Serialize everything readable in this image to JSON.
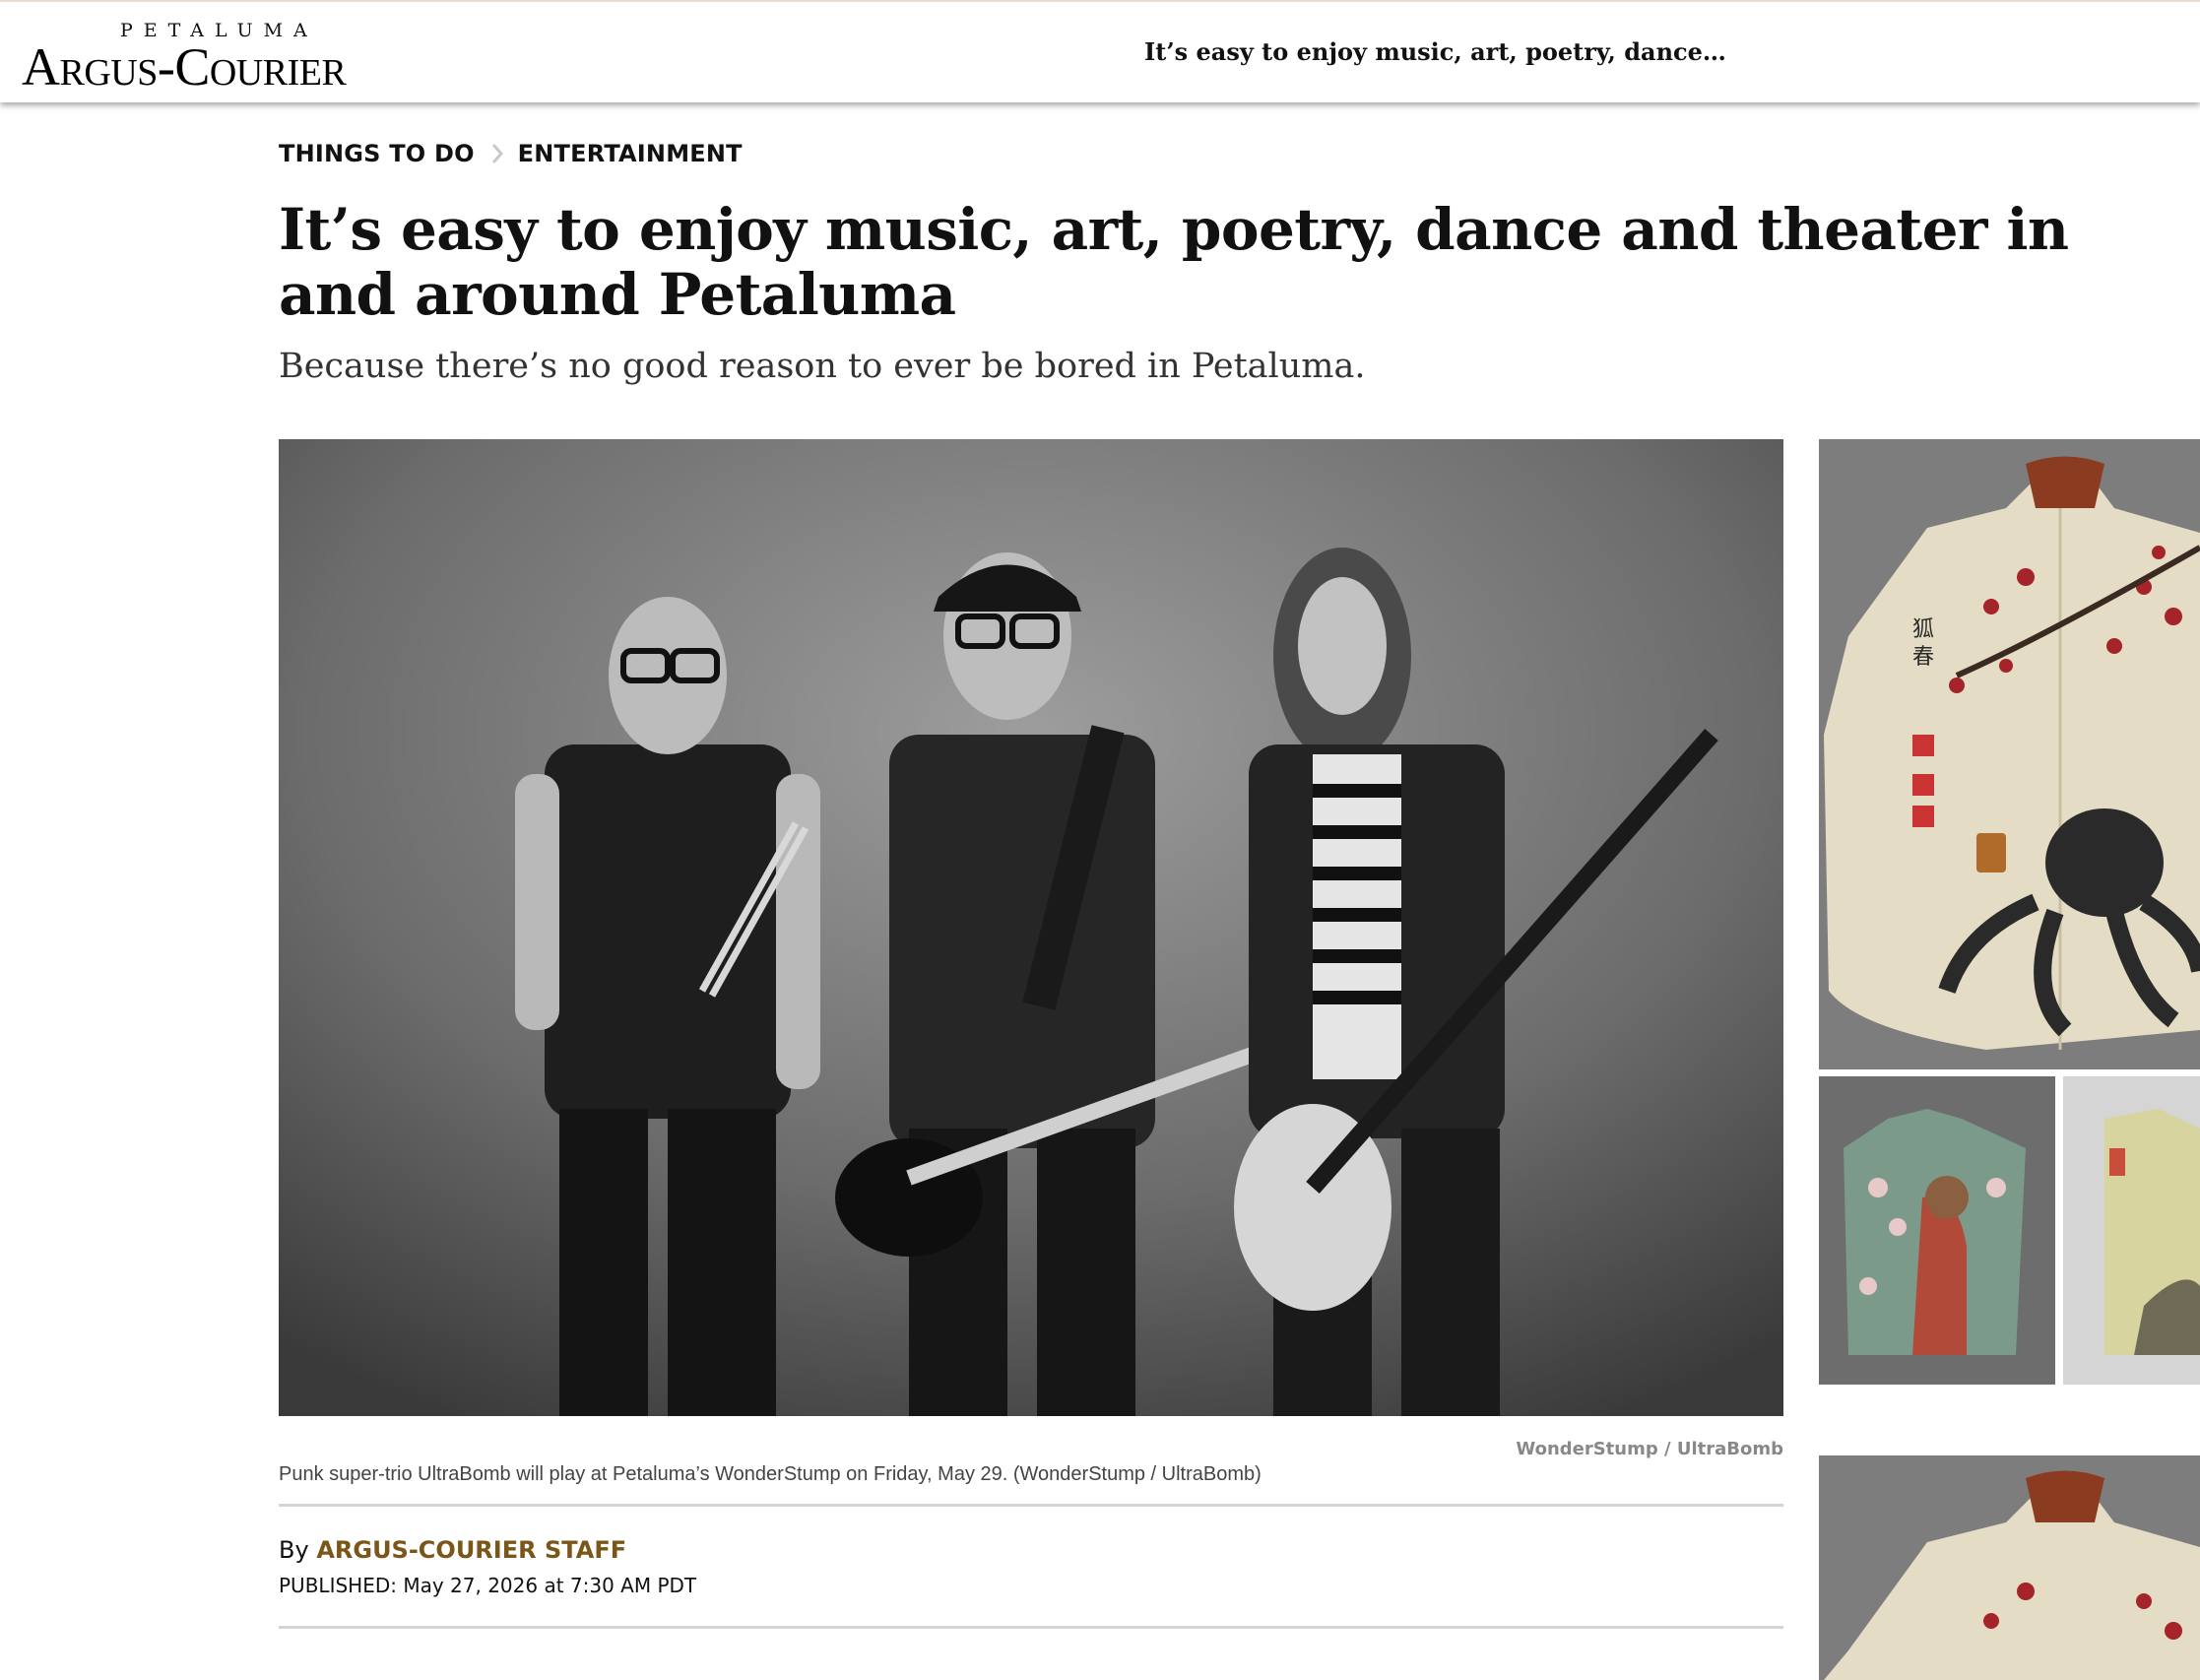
{
  "header": {
    "logo_small": "PETALUMA",
    "logo_main": "Argus-Courier",
    "headline_short": "It’s easy to enjoy music, art, poetry, dance…"
  },
  "breadcrumb": {
    "items": [
      {
        "label": "THINGS TO DO"
      },
      {
        "label": "ENTERTAINMENT"
      }
    ]
  },
  "article": {
    "headline": "It’s easy to enjoy music, art, poetry, dance and theater in and around Petaluma",
    "dek": "Because there’s no good reason to ever be bored in Petaluma.",
    "photo": {
      "credit": "WonderStump / UltraBomb",
      "caption": "Punk super-trio UltraBomb will play at Petaluma’s WonderStump on Friday, May 29. (WonderStump / UltraBomb)"
    },
    "byline": {
      "prefix": "By",
      "author": "ARGUS-COURIER STAFF"
    },
    "published": "PUBLISHED: May 27, 2026 at 7:30 AM PDT"
  },
  "icons": {
    "breadcrumb_separator": "chevron-right-icon"
  },
  "colors": {
    "author_link": "#7a5618",
    "text": "#111111",
    "dek": "#333333",
    "rule": "#d4d4d4",
    "credit": "#888888"
  }
}
